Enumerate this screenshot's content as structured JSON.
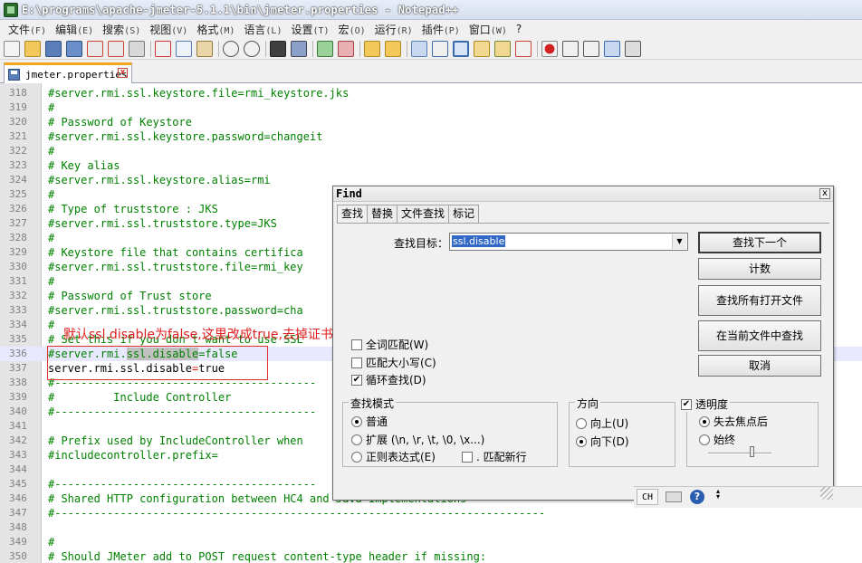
{
  "window": {
    "title": "E:\\programs\\apache-jmeter-5.1.1\\bin\\jmeter.properties - Notepad++"
  },
  "menu": [
    {
      "label": "文件",
      "acc": "(F)"
    },
    {
      "label": "编辑",
      "acc": "(E)"
    },
    {
      "label": "搜索",
      "acc": "(S)"
    },
    {
      "label": "视图",
      "acc": "(V)"
    },
    {
      "label": "格式",
      "acc": "(M)"
    },
    {
      "label": "语言",
      "acc": "(L)"
    },
    {
      "label": "设置",
      "acc": "(T)"
    },
    {
      "label": "宏",
      "acc": "(O)"
    },
    {
      "label": "运行",
      "acc": "(R)"
    },
    {
      "label": "插件",
      "acc": "(P)"
    },
    {
      "label": "窗口",
      "acc": "(W)"
    },
    {
      "label": "?",
      "acc": ""
    }
  ],
  "tab": {
    "filename": "jmeter.properties"
  },
  "editor": {
    "lines": [
      {
        "n": "318",
        "text": "#server.rmi.ssl.keystore.file=rmi_keystore.jks"
      },
      {
        "n": "319",
        "text": "#"
      },
      {
        "n": "320",
        "text": "# Password of Keystore"
      },
      {
        "n": "321",
        "text": "#server.rmi.ssl.keystore.password=changeit"
      },
      {
        "n": "322",
        "text": "#"
      },
      {
        "n": "323",
        "text": "# Key alias"
      },
      {
        "n": "324",
        "text": "#server.rmi.ssl.keystore.alias=rmi"
      },
      {
        "n": "325",
        "text": "#"
      },
      {
        "n": "326",
        "text": "# Type of truststore : JKS"
      },
      {
        "n": "327",
        "text": "#server.rmi.ssl.truststore.type=JKS"
      },
      {
        "n": "328",
        "text": "#"
      },
      {
        "n": "329",
        "text": "# Keystore file that contains certifica"
      },
      {
        "n": "330",
        "text": "#server.rmi.ssl.truststore.file=rmi_key"
      },
      {
        "n": "331",
        "text": "#"
      },
      {
        "n": "332",
        "text": "# Password of Trust store"
      },
      {
        "n": "333",
        "text": "#server.rmi.ssl.truststore.password=cha"
      },
      {
        "n": "334",
        "text": "#"
      },
      {
        "n": "335",
        "text": "# Set this if you don't want to use SSL"
      },
      {
        "n": "336",
        "pre": "#server.rmi.",
        "sel": "ssl.disable",
        "post": "=false"
      },
      {
        "n": "337",
        "key": "server.rmi.ssl.disable",
        "eq": "=",
        "val": "true"
      },
      {
        "n": "338",
        "text": "#----------------------------------------"
      },
      {
        "n": "339",
        "text": "#         Include Controller"
      },
      {
        "n": "340",
        "text": "#----------------------------------------"
      },
      {
        "n": "341",
        "text": ""
      },
      {
        "n": "342",
        "text": "# Prefix used by IncludeController when"
      },
      {
        "n": "343",
        "text": "#includecontroller.prefix="
      },
      {
        "n": "344",
        "text": ""
      },
      {
        "n": "345",
        "text": "#----------------------------------------"
      },
      {
        "n": "346",
        "text": "# Shared HTTP configuration between HC4 and Java Implementations"
      },
      {
        "n": "347",
        "text": "#---------------------------------------------------------------------------"
      },
      {
        "n": "348",
        "text": ""
      },
      {
        "n": "349",
        "text": "#"
      },
      {
        "n": "350",
        "text": "# Should JMeter add to POST request content-type header if missing:"
      }
    ]
  },
  "annotation": "默认ssl.disable为false,这里改成true,去掉证书认证",
  "find": {
    "title": "Find",
    "tabs": [
      "查找",
      "替换",
      "文件查找",
      "标记"
    ],
    "target_label": "查找目标：",
    "target_value": "ssl.disable",
    "buttons": {
      "find_next": "查找下一个",
      "count": "计数",
      "find_all_open": "查找所有打开文件",
      "find_current": "在当前文件中查找",
      "cancel": "取消"
    },
    "options": {
      "whole_word": "全词匹配(W)",
      "match_case": "匹配大小写(C)",
      "wrap": "循环查找(D)"
    },
    "mode": {
      "title": "查找模式",
      "normal": "普通",
      "extended": "扩展 (\\n, \\r, \\t, \\0, \\x...)",
      "regex": "正则表达式(E)",
      "dot_newline": ". 匹配新行"
    },
    "direction": {
      "title": "方向",
      "up": "向上(U)",
      "down": "向下(D)"
    },
    "transparency": {
      "title": "透明度",
      "on_lose_focus": "失去焦点后",
      "always": "始终"
    }
  },
  "status": {
    "ime": "CH"
  }
}
